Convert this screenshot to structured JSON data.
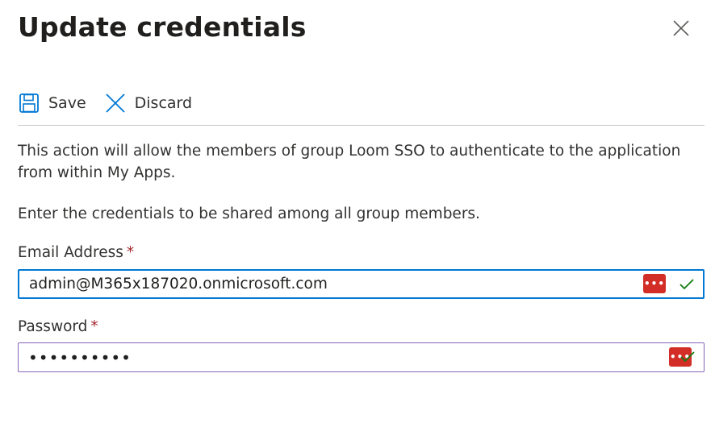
{
  "dialog": {
    "title": "Update credentials",
    "close_icon": "close-icon"
  },
  "toolbar": {
    "save_label": "Save",
    "save_icon": "floppy-disk-icon",
    "discard_label": "Discard",
    "discard_icon": "close-icon"
  },
  "description": {
    "line1": "This action will allow the members of group Loom SSO to authenticate to the application from within My Apps.",
    "line2": "Enter the credentials to be shared among all group members."
  },
  "form": {
    "email": {
      "label": "Email Address",
      "required_marker": "*",
      "value": "admin@M365x187020.onmicrosoft.com",
      "valid": true
    },
    "password": {
      "label": "Password",
      "required_marker": "*",
      "value": "••••••••••",
      "valid": true
    },
    "password_manager_icon": "lastpass-icon",
    "password_manager_glyph": "•••"
  },
  "colors": {
    "accent": "#0078d4",
    "required": "#a4262c",
    "password_border": "#8764b8",
    "valid": "#107c10",
    "password_manager": "#d32d27"
  }
}
